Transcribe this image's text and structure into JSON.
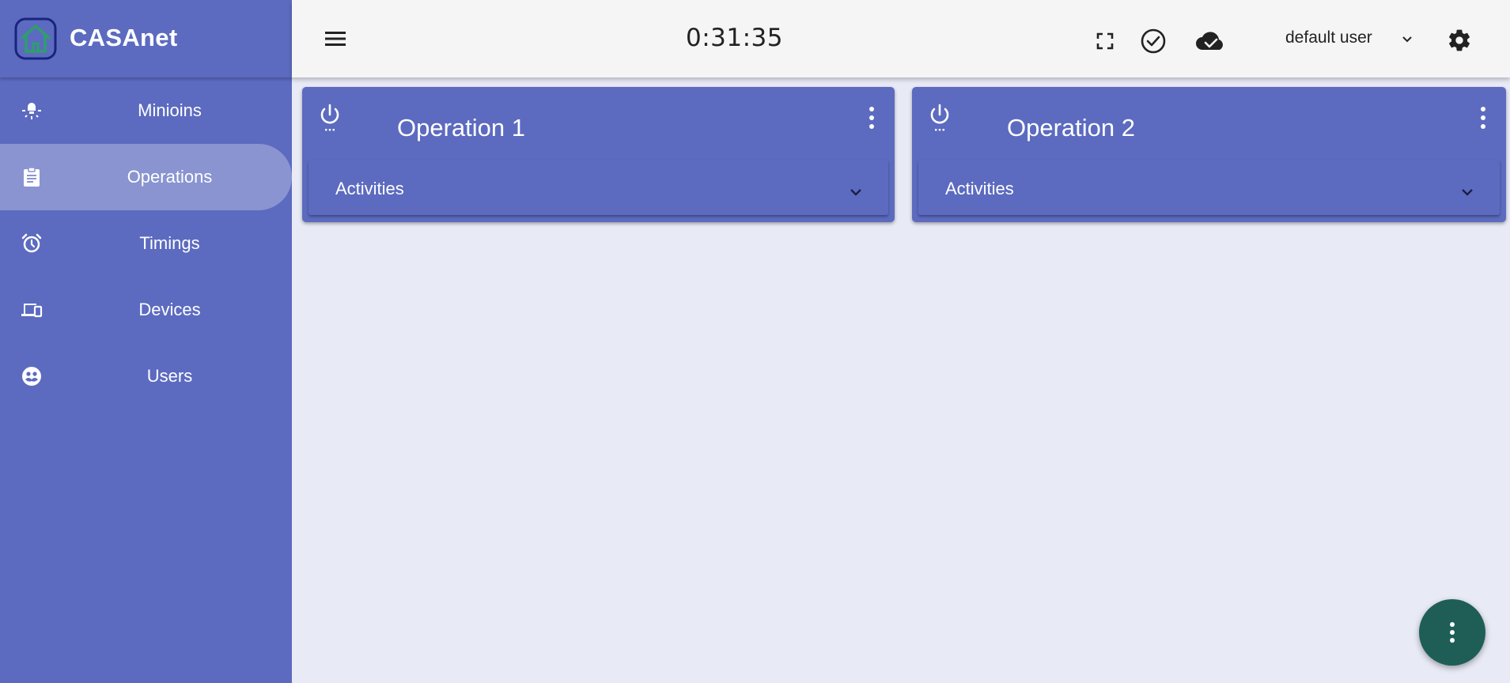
{
  "app": {
    "name": "CASAnet"
  },
  "sidebar": {
    "items": [
      {
        "label": "Minioins",
        "icon": "lightbulb-icon",
        "active": false
      },
      {
        "label": "Operations",
        "icon": "clipboard-icon",
        "active": true
      },
      {
        "label": "Timings",
        "icon": "alarm-icon",
        "active": false
      },
      {
        "label": "Devices",
        "icon": "devices-icon",
        "active": false
      },
      {
        "label": "Users",
        "icon": "users-face-icon",
        "active": false
      }
    ]
  },
  "header": {
    "clock": "0:31:35",
    "user": "default user",
    "icons": [
      "menu-icon",
      "fullscreen-icon",
      "check-circle-icon",
      "cloud-done-icon",
      "chevron-down-icon",
      "gear-icon"
    ]
  },
  "operations": [
    {
      "title": "Operation 1",
      "section_label": "Activities"
    },
    {
      "title": "Operation 2",
      "section_label": "Activities"
    }
  ],
  "colors": {
    "primary": "#5c6bc0",
    "background": "#e8eaf6",
    "topbar": "#f5f5f5",
    "fab": "#1e5e57"
  }
}
